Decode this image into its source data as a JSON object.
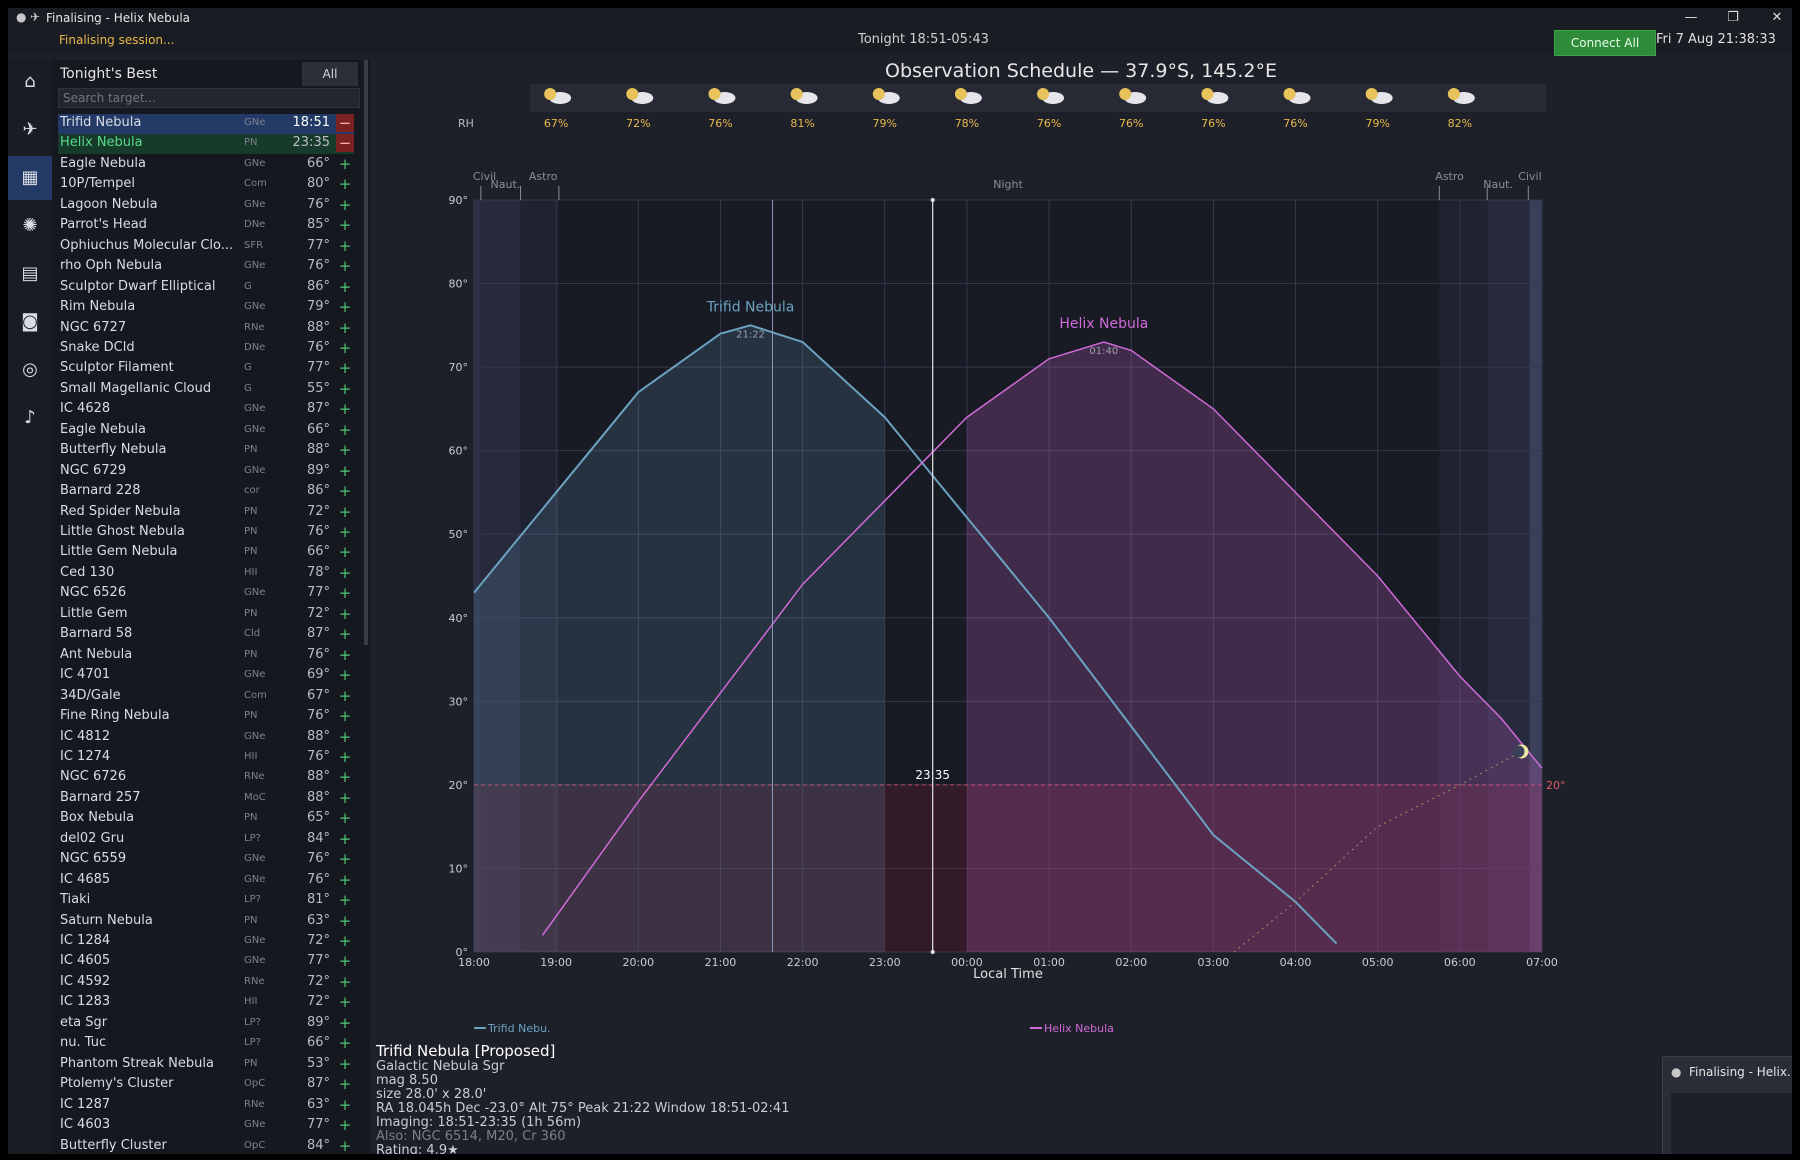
{
  "window": {
    "title": "Finalising - Helix Nebula",
    "status": "Finalising session...",
    "tonight": "Tonight 18:51-05:43",
    "connect_label": "Connect All",
    "clock": "Fri 7 Aug 21:38:33"
  },
  "nav": [
    "home-icon",
    "telescope-icon",
    "calendar-icon",
    "galaxy-icon",
    "film-icon",
    "camera-icon",
    "target-icon",
    "bell-icon"
  ],
  "sidebar": {
    "title": "Tonight's Best",
    "all_label": "All",
    "search_placeholder": "Search target...",
    "items": [
      {
        "name": "Trifid Nebula",
        "type": "GNe",
        "value": "18:51",
        "action": "−",
        "state": "scheduled"
      },
      {
        "name": "Helix Nebula",
        "type": "PN",
        "value": "23:35",
        "action": "−",
        "state": "scheduled"
      },
      {
        "name": "Eagle Nebula",
        "type": "GNe",
        "value": "66°",
        "action": "+"
      },
      {
        "name": "10P/Tempel",
        "type": "Com",
        "value": "80°",
        "action": "+"
      },
      {
        "name": "Lagoon Nebula",
        "type": "GNe",
        "value": "76°",
        "action": "+"
      },
      {
        "name": "Parrot's Head",
        "type": "DNe",
        "value": "85°",
        "action": "+"
      },
      {
        "name": "Ophiuchus Molecular Clo...",
        "type": "SFR",
        "value": "77°",
        "action": "+"
      },
      {
        "name": "rho Oph Nebula",
        "type": "GNe",
        "value": "76°",
        "action": "+"
      },
      {
        "name": "Sculptor Dwarf Elliptical",
        "type": "G",
        "value": "86°",
        "action": "+"
      },
      {
        "name": "Rim Nebula",
        "type": "GNe",
        "value": "79°",
        "action": "+"
      },
      {
        "name": "NGC 6727",
        "type": "RNe",
        "value": "88°",
        "action": "+"
      },
      {
        "name": "Snake DCld",
        "type": "DNe",
        "value": "76°",
        "action": "+"
      },
      {
        "name": "Sculptor Filament",
        "type": "G",
        "value": "77°",
        "action": "+"
      },
      {
        "name": "Small Magellanic Cloud",
        "type": "G",
        "value": "55°",
        "action": "+"
      },
      {
        "name": "IC 4628",
        "type": "GNe",
        "value": "87°",
        "action": "+"
      },
      {
        "name": "Eagle Nebula",
        "type": "GNe",
        "value": "66°",
        "action": "+"
      },
      {
        "name": "Butterfly Nebula",
        "type": "PN",
        "value": "88°",
        "action": "+"
      },
      {
        "name": "NGC 6729",
        "type": "GNe",
        "value": "89°",
        "action": "+"
      },
      {
        "name": "Barnard 228",
        "type": "cor",
        "value": "86°",
        "action": "+"
      },
      {
        "name": "Red Spider Nebula",
        "type": "PN",
        "value": "72°",
        "action": "+"
      },
      {
        "name": "Little Ghost Nebula",
        "type": "PN",
        "value": "76°",
        "action": "+"
      },
      {
        "name": "Little Gem Nebula",
        "type": "PN",
        "value": "66°",
        "action": "+"
      },
      {
        "name": "Ced 130",
        "type": "HII",
        "value": "78°",
        "action": "+"
      },
      {
        "name": "NGC 6526",
        "type": "GNe",
        "value": "77°",
        "action": "+"
      },
      {
        "name": "Little Gem",
        "type": "PN",
        "value": "72°",
        "action": "+"
      },
      {
        "name": "Barnard 58",
        "type": "Cld",
        "value": "87°",
        "action": "+"
      },
      {
        "name": "Ant Nebula",
        "type": "PN",
        "value": "76°",
        "action": "+"
      },
      {
        "name": "IC 4701",
        "type": "GNe",
        "value": "69°",
        "action": "+"
      },
      {
        "name": "34D/Gale",
        "type": "Com",
        "value": "67°",
        "action": "+"
      },
      {
        "name": "Fine Ring Nebula",
        "type": "PN",
        "value": "76°",
        "action": "+"
      },
      {
        "name": "IC 4812",
        "type": "GNe",
        "value": "88°",
        "action": "+"
      },
      {
        "name": "IC 1274",
        "type": "HII",
        "value": "76°",
        "action": "+"
      },
      {
        "name": "NGC 6726",
        "type": "RNe",
        "value": "88°",
        "action": "+"
      },
      {
        "name": "Barnard 257",
        "type": "MoC",
        "value": "88°",
        "action": "+"
      },
      {
        "name": "Box Nebula",
        "type": "PN",
        "value": "65°",
        "action": "+"
      },
      {
        "name": "del02 Gru",
        "type": "LP?",
        "value": "84°",
        "action": "+"
      },
      {
        "name": "NGC 6559",
        "type": "GNe",
        "value": "76°",
        "action": "+"
      },
      {
        "name": "IC 4685",
        "type": "GNe",
        "value": "76°",
        "action": "+"
      },
      {
        "name": "Tiaki",
        "type": "LP?",
        "value": "81°",
        "action": "+"
      },
      {
        "name": "Saturn Nebula",
        "type": "PN",
        "value": "63°",
        "action": "+"
      },
      {
        "name": "IC 1284",
        "type": "GNe",
        "value": "72°",
        "action": "+"
      },
      {
        "name": "IC 4605",
        "type": "GNe",
        "value": "77°",
        "action": "+"
      },
      {
        "name": "IC 4592",
        "type": "RNe",
        "value": "72°",
        "action": "+"
      },
      {
        "name": "IC 1283",
        "type": "HII",
        "value": "72°",
        "action": "+"
      },
      {
        "name": "eta Sgr",
        "type": "LP?",
        "value": "89°",
        "action": "+"
      },
      {
        "name": "nu. Tuc",
        "type": "LP?",
        "value": "66°",
        "action": "+"
      },
      {
        "name": "Phantom Streak Nebula",
        "type": "PN",
        "value": "53°",
        "action": "+"
      },
      {
        "name": "Ptolemy's Cluster",
        "type": "OpC",
        "value": "87°",
        "action": "+"
      },
      {
        "name": "IC 1287",
        "type": "RNe",
        "value": "63°",
        "action": "+"
      },
      {
        "name": "IC 4603",
        "type": "GNe",
        "value": "77°",
        "action": "+"
      },
      {
        "name": "Butterfly Cluster",
        "type": "OpC",
        "value": "84°",
        "action": "+"
      }
    ]
  },
  "chart_data": {
    "type": "line",
    "title": "Observation Schedule — 37.9°S, 145.2°E",
    "xlabel": "Local Time",
    "ylabel": "",
    "xlim": [
      "18:00",
      "07:00"
    ],
    "ylim": [
      0,
      90
    ],
    "x_ticks": [
      "18:00",
      "19:00",
      "20:00",
      "21:00",
      "22:00",
      "23:00",
      "00:00",
      "01:00",
      "02:00",
      "03:00",
      "04:00",
      "05:00",
      "06:00",
      "07:00"
    ],
    "y_ticks": [
      "0°",
      "10°",
      "20°",
      "30°",
      "40°",
      "50°",
      "60°",
      "70°",
      "80°",
      "90°"
    ],
    "rh_label": "RH",
    "weather": [
      {
        "time": "19:00",
        "rh": "67%"
      },
      {
        "time": "20:00",
        "rh": "72%"
      },
      {
        "time": "21:00",
        "rh": "76%"
      },
      {
        "time": "22:00",
        "rh": "81%"
      },
      {
        "time": "23:00",
        "rh": "79%"
      },
      {
        "time": "00:00",
        "rh": "78%"
      },
      {
        "time": "01:00",
        "rh": "76%"
      },
      {
        "time": "02:00",
        "rh": "76%"
      },
      {
        "time": "03:00",
        "rh": "76%"
      },
      {
        "time": "04:00",
        "rh": "76%"
      },
      {
        "time": "05:00",
        "rh": "79%"
      },
      {
        "time": "06:00",
        "rh": "82%"
      }
    ],
    "twilight_labels": {
      "civil_start": "Civil",
      "naut_start": "Naut.",
      "astro_start": "Astro",
      "night": "Night",
      "astro_end": "Astro",
      "naut_end": "Naut.",
      "civil_end": "Civil"
    },
    "twilight_times": {
      "civil": [
        "18:05",
        "06:50"
      ],
      "nautical": [
        "18:34",
        "06:20"
      ],
      "astronomical": [
        "19:02",
        "05:45"
      ]
    },
    "min_alt": 20,
    "min_alt_label": "20°",
    "switch_time": "23:35",
    "switch_label": "23:35",
    "now_time": "21:38",
    "series": [
      {
        "name": "Trifid Nebula",
        "legend": "Trifid Nebu.",
        "color": "#6aa2c0",
        "peak_time": "21:22",
        "peak_alt": 75,
        "peak_label": "21:22",
        "points": [
          [
            "18:00",
            43
          ],
          [
            "19:00",
            55
          ],
          [
            "20:00",
            67
          ],
          [
            "21:00",
            74
          ],
          [
            "21:22",
            75
          ],
          [
            "22:00",
            73
          ],
          [
            "23:00",
            64
          ],
          [
            "00:00",
            52
          ],
          [
            "01:00",
            40
          ],
          [
            "02:00",
            27
          ],
          [
            "03:00",
            14
          ],
          [
            "04:00",
            6
          ],
          [
            "04:30",
            1
          ]
        ]
      },
      {
        "name": "Helix Nebula",
        "legend": "Helix Nebula",
        "color": "#d06ad8",
        "peak_time": "01:40",
        "peak_alt": 73,
        "peak_label": "01:40",
        "points": [
          [
            "18:50",
            2
          ],
          [
            "20:00",
            18
          ],
          [
            "21:00",
            31
          ],
          [
            "22:00",
            44
          ],
          [
            "23:00",
            54
          ],
          [
            "00:00",
            64
          ],
          [
            "01:00",
            71
          ],
          [
            "01:40",
            73
          ],
          [
            "02:00",
            72
          ],
          [
            "03:00",
            65
          ],
          [
            "04:00",
            55
          ],
          [
            "05:00",
            45
          ],
          [
            "06:00",
            33
          ],
          [
            "06:30",
            28
          ],
          [
            "07:00",
            22
          ]
        ]
      },
      {
        "name": "Moon",
        "color": "#8a9a6a",
        "points": [
          [
            "03:15",
            0
          ],
          [
            "04:00",
            6
          ],
          [
            "05:00",
            15
          ],
          [
            "06:00",
            20
          ],
          [
            "06:45",
            24
          ]
        ]
      }
    ]
  },
  "details": {
    "title": "Trifid Nebula [Proposed]",
    "type": "Galactic Nebula Sgr",
    "mag": "mag 8.50",
    "size": "size 28.0' x 28.0'",
    "coords": "RA 18.045h Dec -23.0° Alt 75° Peak 21:22 Window 18:51-02:41",
    "imaging": "Imaging: 18:51-23:35 (1h 56m)",
    "also": "Also: NGC 6514, M20, Cr 360",
    "rating": "Rating: 4.9★"
  },
  "thumbnail": {
    "title": "Finalising - Helix..."
  }
}
